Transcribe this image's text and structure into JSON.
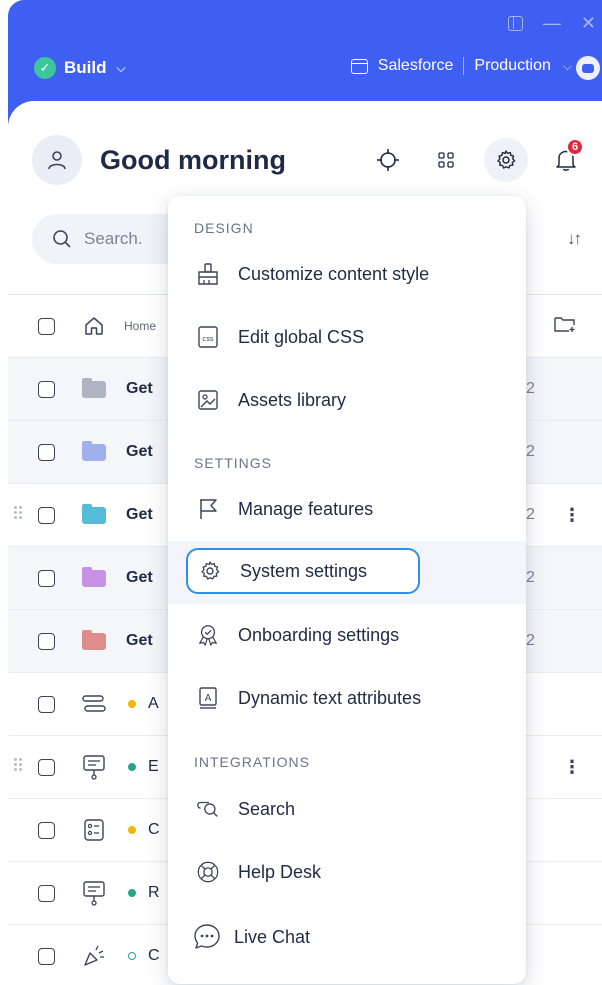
{
  "topbar": {
    "workspace": "Build",
    "platform": "Salesforce",
    "environment": "Production"
  },
  "header": {
    "greeting": "Good morning",
    "notification_count": "6"
  },
  "search": {
    "placeholder": "Search."
  },
  "list": {
    "home_label": "Home",
    "rows": [
      {
        "text": "Get",
        "count": "2",
        "color": "#aeb4c2"
      },
      {
        "text": "Get",
        "count": "2",
        "color": "#9fb0ea"
      },
      {
        "text": "Get",
        "count": "2",
        "color": "#55bcd8"
      },
      {
        "text": "Get",
        "count": "2",
        "color": "#c792e6"
      },
      {
        "text": "Get",
        "count": "2",
        "color": "#dd8e88"
      }
    ],
    "items": [
      {
        "text": "A",
        "dot": "#f4b400"
      },
      {
        "text": "E",
        "dot": "#27a58a"
      },
      {
        "text": "C",
        "dot": "#f4b400"
      },
      {
        "text": "R",
        "dot": "#27a58a"
      },
      {
        "text": "C",
        "dot": "#27a58a"
      }
    ]
  },
  "menu": {
    "design_header": "DESIGN",
    "design_items": [
      {
        "label": "Customize content style",
        "icon": "paint-roller-icon"
      },
      {
        "label": "Edit global CSS",
        "icon": "css-file-icon"
      },
      {
        "label": "Assets library",
        "icon": "image-icon"
      }
    ],
    "settings_header": "SETTINGS",
    "settings_items": [
      {
        "label": "Manage features",
        "icon": "flag-icon"
      },
      {
        "label": "System settings",
        "icon": "gear-icon"
      },
      {
        "label": "Onboarding settings",
        "icon": "badge-check-icon"
      },
      {
        "label": "Dynamic text attributes",
        "icon": "text-attribute-icon"
      }
    ],
    "integrations_header": "INTEGRATIONS",
    "integrations_items": [
      {
        "label": "Search",
        "icon": "search-chat-icon"
      },
      {
        "label": "Help Desk",
        "icon": "lifebuoy-icon"
      },
      {
        "label": "Live Chat",
        "icon": "chat-bubble-icon"
      }
    ]
  },
  "colors": {
    "brand_blue": "#3f5ef2",
    "selection_border": "#2e90e6",
    "badge_red": "#e5273d",
    "success_green": "#3cc79a"
  }
}
